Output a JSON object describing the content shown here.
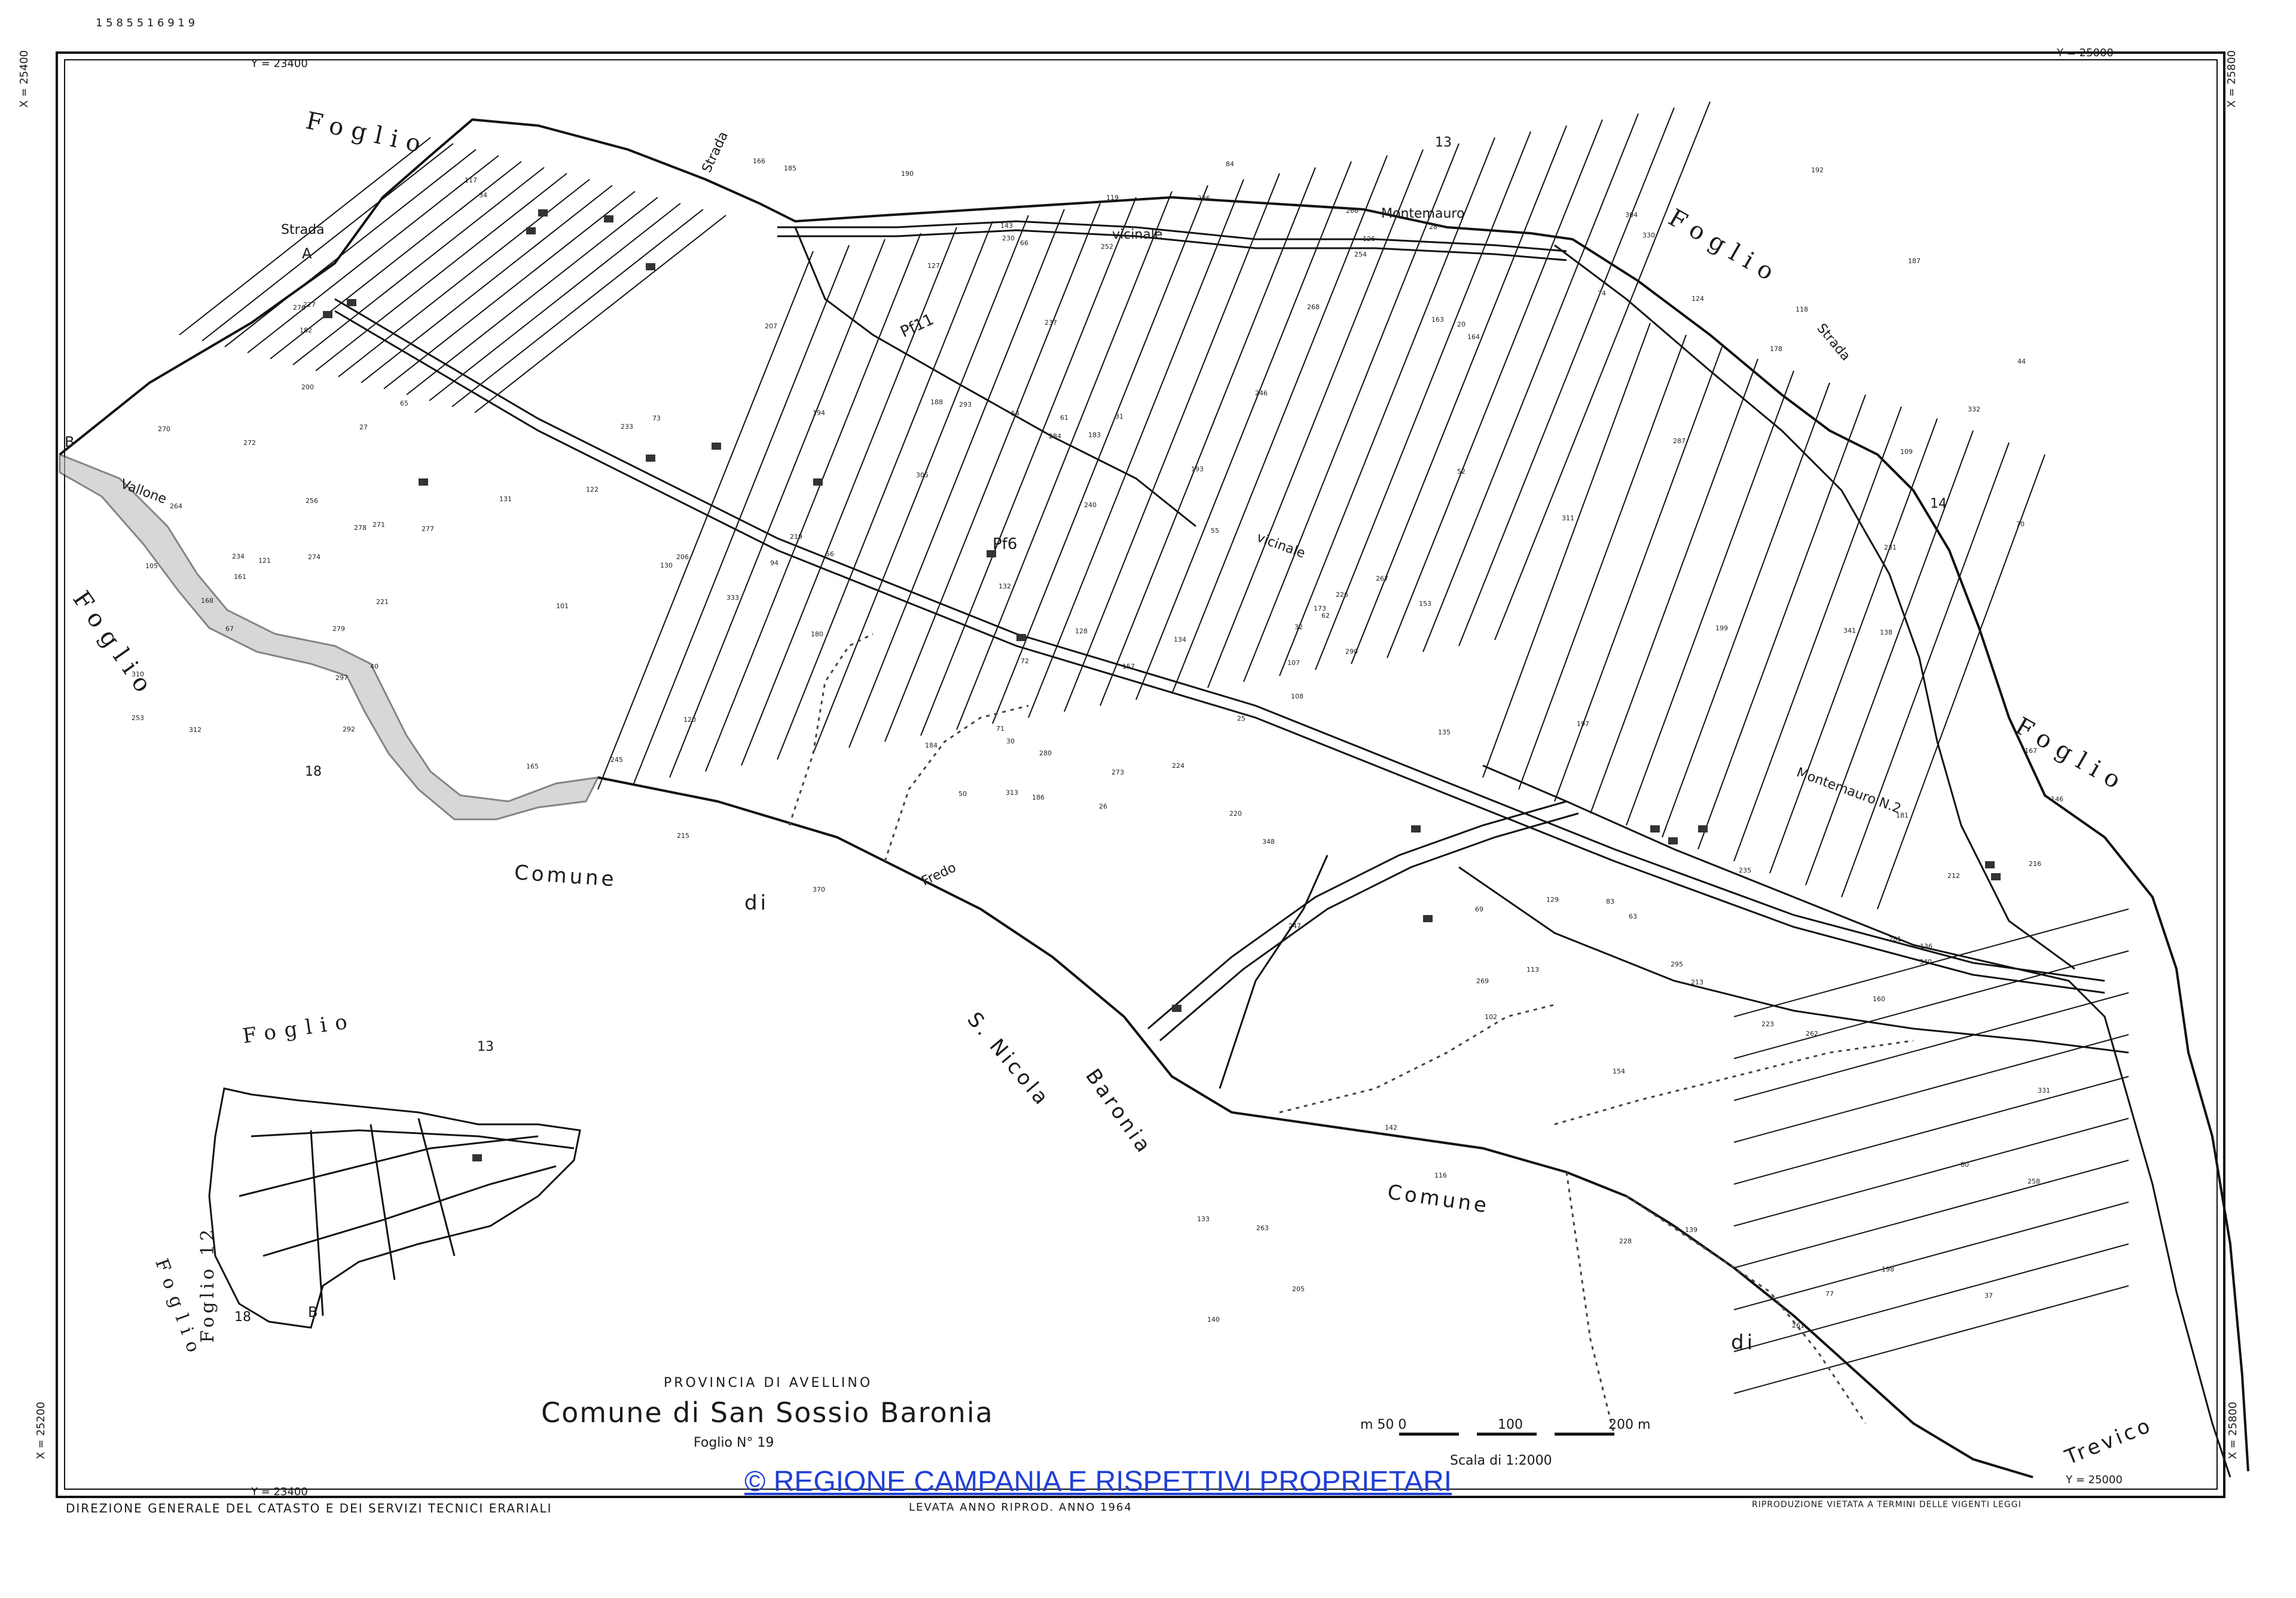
{
  "map": {
    "colors": {
      "ink": "#111111",
      "paper": "#ffffff",
      "copyright": "#1f3fd6",
      "river": "#8a8a8a"
    },
    "header_code": "1 5 8 5 5 1 6   9   1 9",
    "grid": {
      "y_top_left": "Y = 23400",
      "y_top_right": "Y = 25000",
      "x_top_left": "X = 25400",
      "x_top_right": "X = 25800",
      "x_bottom_left": "X = 25200",
      "y_bottom_left": "Y = 23400",
      "y_bottom_right": "Y = 25000",
      "x_bottom_right": "X = 25800"
    },
    "place_labels": {
      "foglio_nw": "Foglio",
      "foglio_w": "Foglio",
      "foglio_ne": "Foglio",
      "foglio_e": "Foglio",
      "foglio_inset": "Foglio",
      "foglio_inset_12": "Foglio 12",
      "foglio_inset_sw": "Foglio",
      "comune_1": "Comune",
      "comune_di_1": "di",
      "san_nicola": "S. Nicola",
      "baronia": "Baronia",
      "comune_2": "Comune",
      "comune_di_2": "di",
      "trevico": "Trevico",
      "sheet_13": "13",
      "sheet_13_inset": "13",
      "sheet_14": "14",
      "sheet_18": "18",
      "sheet_18_inset": "18",
      "point_a": "A",
      "point_b": "B",
      "point_b_inset": "B",
      "strada_1": "Strada",
      "strada_2": "Strada",
      "strada_3": "Strada",
      "vicinale_1": "vicinale",
      "vicinale_2": "vicinale",
      "montemauro_1": "Montemauro",
      "montemauro_2": "Montemauro N.2",
      "vallone": "Vallone",
      "fredo": "Fredo",
      "pf11": "Pf11",
      "pf6": "Pf6"
    },
    "parcels": [
      "26",
      "27",
      "30",
      "32",
      "28",
      "31",
      "20",
      "25",
      "34",
      "37",
      "40",
      "44",
      "50",
      "52",
      "54",
      "55",
      "56",
      "61",
      "62",
      "63",
      "65",
      "66",
      "67",
      "69",
      "70",
      "71",
      "72",
      "73",
      "74",
      "77",
      "80",
      "83",
      "84",
      "94",
      "101",
      "102",
      "105",
      "107",
      "108",
      "109",
      "113",
      "116",
      "117",
      "118",
      "119",
      "120",
      "121",
      "122",
      "124",
      "126",
      "127",
      "128",
      "129",
      "130",
      "131",
      "132",
      "133",
      "134",
      "135",
      "136",
      "138",
      "139",
      "140",
      "142",
      "143",
      "146",
      "153",
      "154",
      "157",
      "160",
      "161",
      "163",
      "164",
      "165",
      "166",
      "167",
      "168",
      "173",
      "178",
      "180",
      "181",
      "182",
      "183",
      "184",
      "185",
      "186",
      "187",
      "188",
      "190",
      "192",
      "193",
      "194",
      "197",
      "198",
      "199",
      "200",
      "205",
      "206",
      "207",
      "212",
      "213",
      "215",
      "216",
      "219",
      "220",
      "221",
      "223",
      "224",
      "226",
      "227",
      "228",
      "230",
      "231",
      "233",
      "234",
      "235",
      "236",
      "237",
      "240",
      "245",
      "246",
      "247",
      "252",
      "253",
      "254",
      "256",
      "258",
      "261",
      "262",
      "263",
      "264",
      "266",
      "267",
      "268",
      "269",
      "270",
      "271",
      "272",
      "273",
      "274",
      "276",
      "277",
      "278",
      "279",
      "280",
      "281",
      "284",
      "287",
      "290",
      "292",
      "293",
      "295",
      "297",
      "304",
      "305",
      "310",
      "311",
      "312",
      "313",
      "330",
      "331",
      "332",
      "333",
      "340",
      "341",
      "348",
      "370"
    ],
    "title": {
      "province": "PROVINCIA DI AVELLINO",
      "comune": "Comune di San Sossio Baronia",
      "sheet": "Foglio N° 19"
    },
    "scale": {
      "label": "Scala di 1:2000",
      "ticks": [
        "m 50 0",
        "100",
        "200 m"
      ]
    },
    "copyright": "© REGIONE CAMPANIA E RISPETTIVI PROPRIETARI",
    "footer": {
      "left": "DIREZIONE GENERALE DEL CATASTO E DEI SERVIZI TECNICI ERARIALI",
      "middle": "LEVATA ANNO      RIPROD. ANNO 1964",
      "right": "RIPRODUZIONE VIETATA A TERMINI DELLE VIGENTI LEGGI"
    }
  }
}
